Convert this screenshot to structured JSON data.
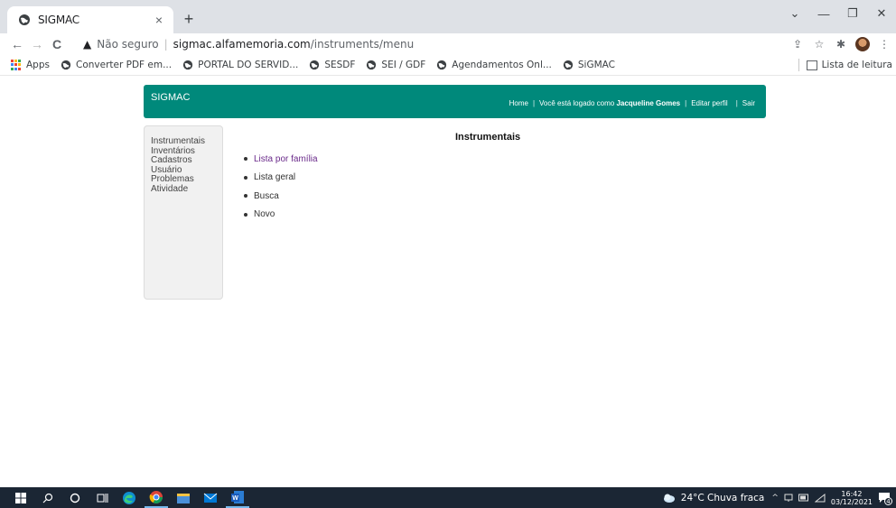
{
  "browser": {
    "tab_title": "SIGMAC",
    "tab_close": "×",
    "new_tab": "+",
    "window_controls": {
      "minimize": "—",
      "restore": "❐",
      "close": "✕",
      "tabs_menu": "⌄"
    },
    "nav": {
      "back": "←",
      "forward": "→",
      "reload": "C"
    },
    "omnibox": {
      "warning": "▲",
      "security_label": "Não seguro",
      "separator": "|",
      "host": "sigmac.alfamemoria.com",
      "path": "/instruments/menu"
    },
    "toolbar_icons": {
      "share": "⇪",
      "star": "☆",
      "extensions": "✱",
      "menu": "⋮"
    },
    "bookmarks": [
      {
        "label": "Apps",
        "icon": "apps-grid-icon"
      },
      {
        "label": "Converter PDF em...",
        "icon": "globe-icon"
      },
      {
        "label": "PORTAL DO SERVID...",
        "icon": "globe-icon"
      },
      {
        "label": "SESDF",
        "icon": "globe-icon"
      },
      {
        "label": "SEI / GDF",
        "icon": "globe-icon"
      },
      {
        "label": "Agendamentos Onl...",
        "icon": "globe-icon"
      },
      {
        "label": "SiGMAC",
        "icon": "globe-icon"
      }
    ],
    "reading_list": "Lista de leitura"
  },
  "app": {
    "logo": "SIGMAC",
    "nav": {
      "home": "Home",
      "user_text": "Você está logado como",
      "user_name": "Jacqueline Gomes",
      "edit_profile": "Editar perfil",
      "logout": "Sair",
      "separator": "|"
    },
    "sidebar": [
      "Instrumentais",
      "Inventários",
      "Cadastros",
      "Usuário",
      "Problemas",
      "Atividade"
    ],
    "content": {
      "title": "Instrumentais",
      "items": [
        "Lista por família",
        "Lista geral",
        "Busca",
        "Novo"
      ]
    },
    "colors": {
      "header": "#00897b",
      "visited_link": "#6a2a8a"
    }
  },
  "taskbar": {
    "weather": "24°C  Chuva fraca",
    "time": "16:42",
    "date": "03/12/2021",
    "notifications": "4",
    "tray_caret": "^"
  }
}
